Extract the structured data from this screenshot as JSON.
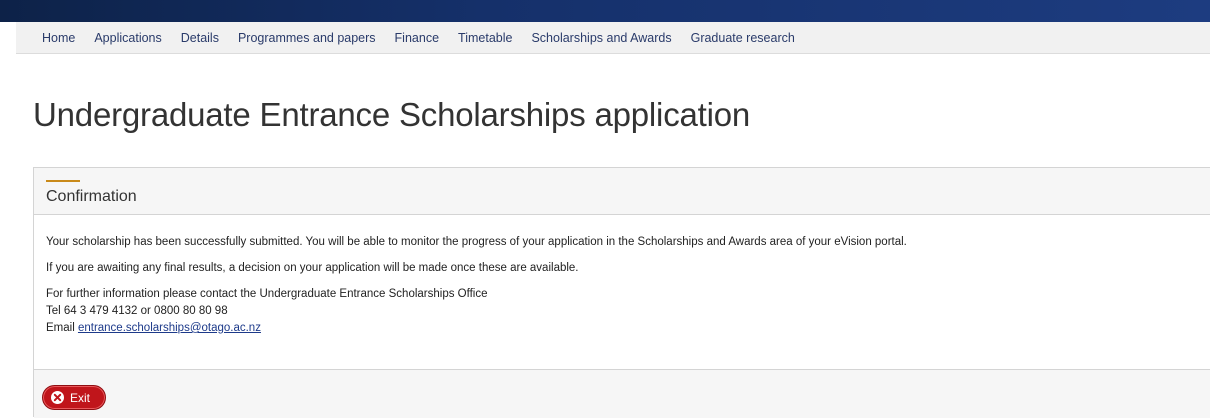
{
  "nav": {
    "items": [
      {
        "label": "Home"
      },
      {
        "label": "Applications"
      },
      {
        "label": "Details"
      },
      {
        "label": "Programmes and papers"
      },
      {
        "label": "Finance"
      },
      {
        "label": "Timetable"
      },
      {
        "label": "Scholarships and Awards"
      },
      {
        "label": "Graduate research"
      }
    ]
  },
  "page": {
    "title": "Undergraduate Entrance Scholarships application"
  },
  "confirmation": {
    "heading": "Confirmation",
    "paragraph1": "Your scholarship has been successfully submitted. You will be able to monitor the progress of your application in the Scholarships and Awards area of your eVision portal.",
    "paragraph2": "If you are awaiting any final results, a decision on your application will be made once these are available.",
    "contact_line": "For further information please contact the Undergraduate Entrance Scholarships Office",
    "tel_line": "Tel 64 3 479 4132 or 0800 80 80 98",
    "email_prefix": "Email ",
    "email": "entrance.scholarships@otago.ac.nz"
  },
  "footer": {
    "exit_label": "Exit"
  },
  "colors": {
    "accent": "#c98a1a",
    "exit_button": "#c0151b",
    "top_bar": "#15306a",
    "link": "#1d3a8a"
  },
  "icons": {
    "exit": "close-circle-icon"
  }
}
